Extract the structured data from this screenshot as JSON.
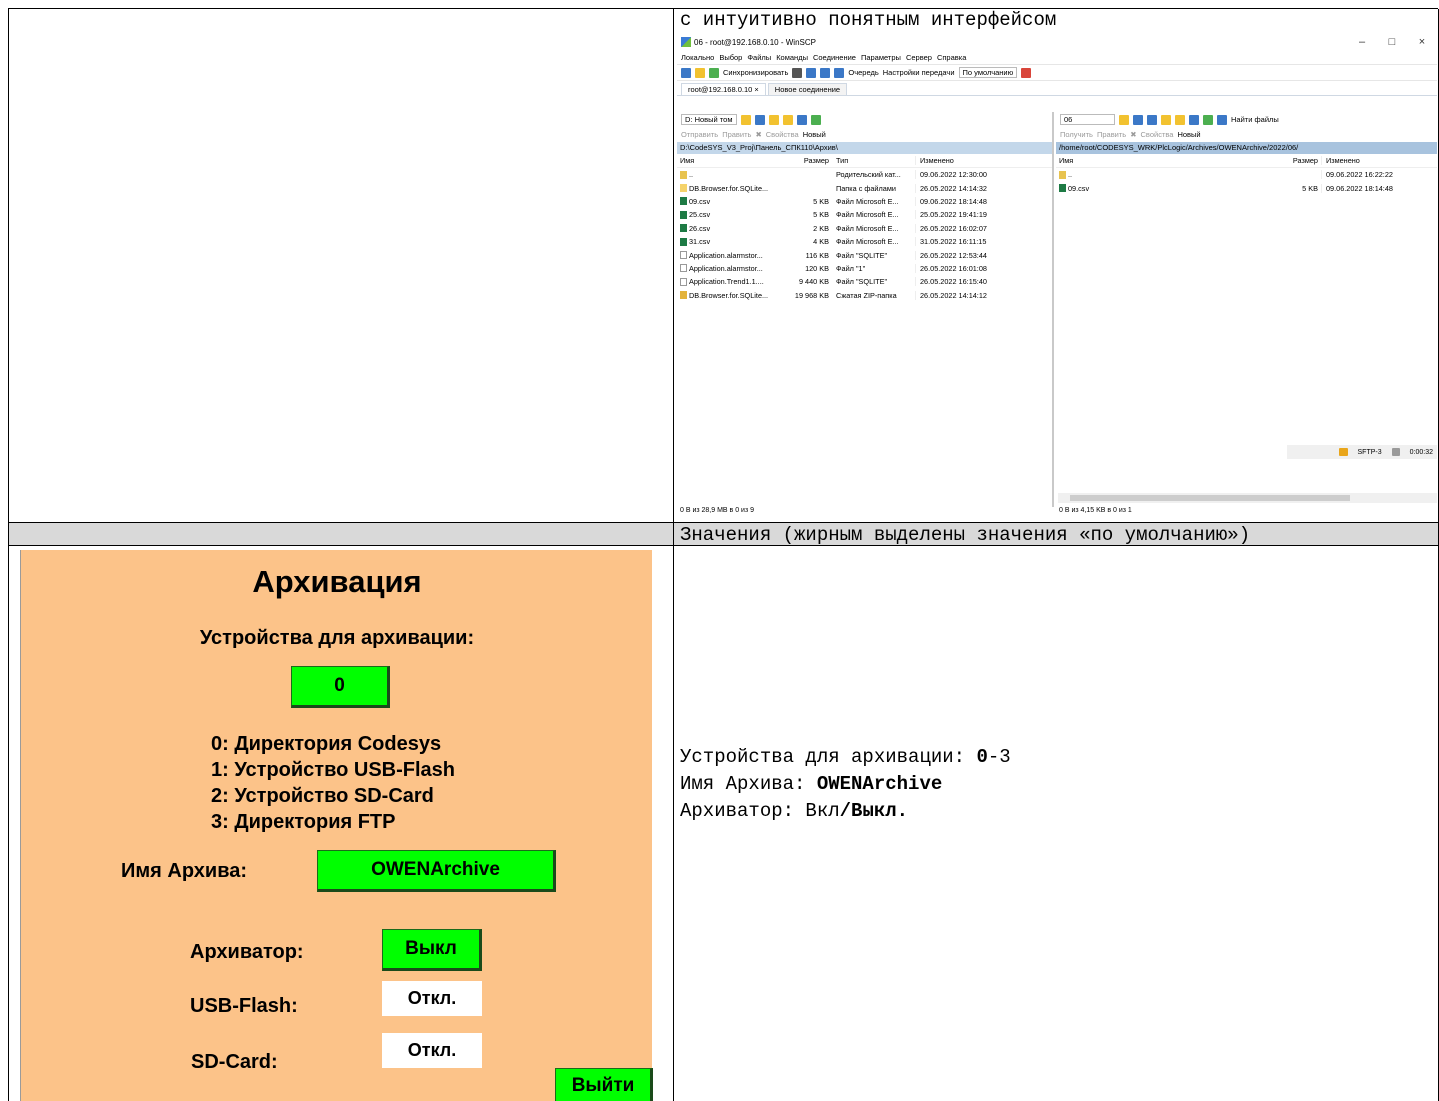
{
  "top_caption": "с интуитивно понятным интерфейсом",
  "section_caption": "Значения (жирным выделены значения «по умолчанию»)",
  "winscp": {
    "title": "06 - root@192.168.0.10 - WinSCP",
    "win_buttons": [
      "–",
      "□",
      "×"
    ],
    "menu": [
      "Локально",
      "Выбор",
      "Файлы",
      "Команды",
      "Соединение",
      "Параметры",
      "Сервер",
      "Справка"
    ],
    "toolbar": {
      "sync": "Синхронизировать",
      "queue": "Очередь",
      "transfer_settings": "Настройки передачи",
      "default": "По умолчанию"
    },
    "tabs": [
      "root@192.168.0.10 ×",
      "Новое соединение"
    ],
    "left": {
      "drive": "D: Новый том",
      "actions": {
        "send": "Отправить",
        "edit": "Править",
        "props": "Свойства",
        "new": "Новый"
      },
      "path": "D:\\CodeSYS_V3_Proj\\Панель_СПК110\\Архив\\",
      "headers": {
        "name": "Имя",
        "size": "Размер",
        "type": "Тип",
        "changed": "Изменено"
      },
      "rows": [
        {
          "icon": "up",
          "name": "..",
          "size": "",
          "type": "Родительский кат...",
          "changed": "09.06.2022 12:30:00"
        },
        {
          "icon": "dir",
          "name": "DB.Browser.for.SQLite...",
          "size": "",
          "type": "Папка с файлами",
          "changed": "26.05.2022 14:14:32"
        },
        {
          "icon": "xls",
          "name": "09.csv",
          "size": "5 KB",
          "type": "Файл Microsoft E...",
          "changed": "09.06.2022 18:14:48"
        },
        {
          "icon": "xls",
          "name": "25.csv",
          "size": "5 KB",
          "type": "Файл Microsoft E...",
          "changed": "25.05.2022 19:41:19"
        },
        {
          "icon": "xls",
          "name": "26.csv",
          "size": "2 KB",
          "type": "Файл Microsoft E...",
          "changed": "26.05.2022 16:02:07"
        },
        {
          "icon": "xls",
          "name": "31.csv",
          "size": "4 KB",
          "type": "Файл Microsoft E...",
          "changed": "31.05.2022 16:11:15"
        },
        {
          "icon": "doc",
          "name": "Application.alarmstor...",
          "size": "116 KB",
          "type": "Файл \"SQLITE\"",
          "changed": "26.05.2022 12:53:44"
        },
        {
          "icon": "doc",
          "name": "Application.alarmstor...",
          "size": "120 KB",
          "type": "Файл \"1\"",
          "changed": "26.05.2022 16:01:08"
        },
        {
          "icon": "doc",
          "name": "Application.Trend1.1....",
          "size": "9 440 KB",
          "type": "Файл \"SQLITE\"",
          "changed": "26.05.2022 16:15:40"
        },
        {
          "icon": "zip",
          "name": "DB.Browser.for.SQLite...",
          "size": "19 968 KB",
          "type": "Сжатая ZIP-папка",
          "changed": "26.05.2022 14:14:12"
        }
      ],
      "status": "0 B из 28,9 MB в 0 из 9"
    },
    "right": {
      "dir": "06",
      "find": "Найти файлы",
      "actions": {
        "get": "Получить",
        "edit": "Править",
        "props": "Свойства",
        "new": "Новый"
      },
      "path": "/home/root/CODESYS_WRK/PlcLogic/Archives/OWENArchive/2022/06/",
      "headers": {
        "name": "Имя",
        "size": "Размер",
        "changed": "Изменено"
      },
      "rows": [
        {
          "icon": "up",
          "name": "..",
          "size": "",
          "changed": "09.06.2022 16:22:22"
        },
        {
          "icon": "xls",
          "name": "09.csv",
          "size": "5 KB",
          "changed": "09.06.2022 18:14:48"
        }
      ],
      "status": "0 B из 4,15 KB в 0 из 1"
    },
    "bottom": {
      "protocol": "SFTP-3",
      "time": "0:00:32"
    }
  },
  "hmi": {
    "title": "Архивация",
    "devices_label": "Устройства для архивации:",
    "devices_value": "0",
    "device_list": [
      "0: Директория Codesys",
      "1: Устройство USB-Flash",
      "2: Устройство SD-Card",
      "3: Директория FTP"
    ],
    "archive_name_label": "Имя Архива:",
    "archive_name_value": "OWENArchive",
    "archiver_label": "Архиватор:",
    "archiver_value": "Выкл",
    "usb_label": "USB-Flash:",
    "usb_value": "Откл.",
    "sd_label": "SD-Card:",
    "sd_value": "Откл.",
    "exit_label": "Выйти",
    "colors": {
      "background": "#fcc389",
      "button": "#00ff00"
    }
  },
  "values": {
    "devices_label": "Устройства для архивации: ",
    "devices_default": "0",
    "devices_rest": "-3",
    "name_label": "Имя Архива: ",
    "name_default": "OWENArchive",
    "archiver_label": "Архиватор: ",
    "archiver_on": "Вкл",
    "archiver_default": "/Выкл."
  }
}
